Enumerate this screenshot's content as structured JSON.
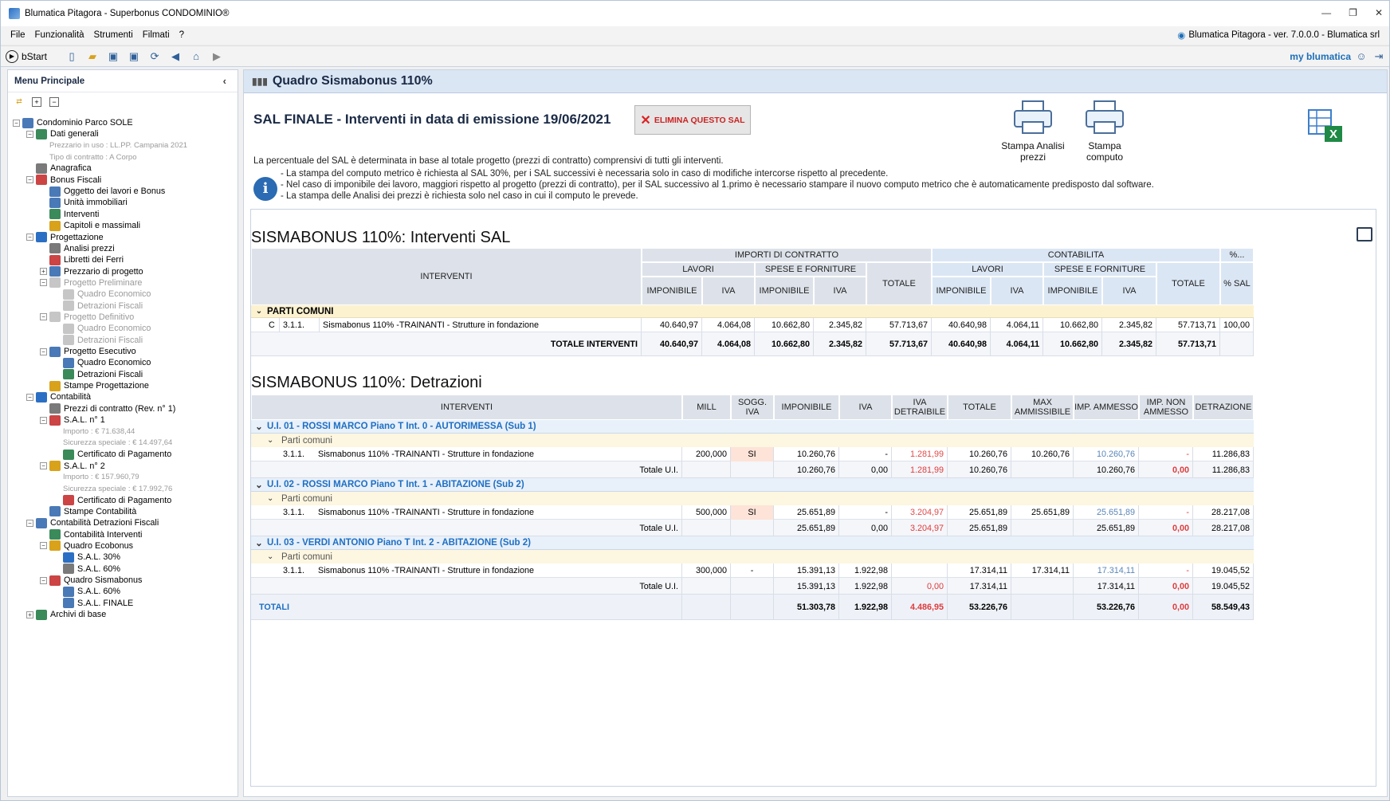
{
  "window": {
    "title": "Blumatica Pitagora - Superbonus CONDOMINIO®",
    "version": "Blumatica Pitagora - ver. 7.0.0.0 - Blumatica srl"
  },
  "menu": [
    "File",
    "Funzionalità",
    "Strumenti",
    "Filmati",
    "?"
  ],
  "toolbar": {
    "bstart": "bStart",
    "brand": "my blumatica"
  },
  "sidebar": {
    "title": "Menu Principale",
    "tree": [
      {
        "label": "Condominio Parco SOLE",
        "level": 0,
        "exp": "-"
      },
      {
        "label": "Dati generali",
        "level": 1,
        "exp": "-"
      },
      {
        "label": "Prezzario in uso : LL.PP. Campania 2021",
        "level": 2,
        "grey": true
      },
      {
        "label": "Tipo di contratto : A Corpo",
        "level": 2,
        "grey": true
      },
      {
        "label": "Anagrafica",
        "level": 1
      },
      {
        "label": "Bonus Fiscali",
        "level": 1,
        "exp": "-"
      },
      {
        "label": "Oggetto dei lavori e Bonus",
        "level": 2
      },
      {
        "label": "Unità immobiliari",
        "level": 2
      },
      {
        "label": "Interventi",
        "level": 2
      },
      {
        "label": "Capitoli e massimali",
        "level": 2
      },
      {
        "label": "Progettazione",
        "level": 1,
        "exp": "-"
      },
      {
        "label": "Analisi prezzi",
        "level": 2
      },
      {
        "label": "Libretti dei Ferri",
        "level": 2
      },
      {
        "label": "Prezzario di progetto",
        "level": 2,
        "exp": "+"
      },
      {
        "label": "Progetto Preliminare",
        "level": 2,
        "exp": "-",
        "dim": true
      },
      {
        "label": "Quadro Economico",
        "level": 3,
        "dim": true
      },
      {
        "label": "Detrazioni Fiscali",
        "level": 3,
        "dim": true
      },
      {
        "label": "Progetto Definitivo",
        "level": 2,
        "exp": "-",
        "dim": true
      },
      {
        "label": "Quadro Economico",
        "level": 3,
        "dim": true
      },
      {
        "label": "Detrazioni Fiscali",
        "level": 3,
        "dim": true
      },
      {
        "label": "Progetto Esecutivo",
        "level": 2,
        "exp": "-"
      },
      {
        "label": "Quadro Economico",
        "level": 3
      },
      {
        "label": "Detrazioni Fiscali",
        "level": 3
      },
      {
        "label": "Stampe Progettazione",
        "level": 2
      },
      {
        "label": "Contabilità",
        "level": 1,
        "exp": "-"
      },
      {
        "label": "Prezzi di contratto (Rev. n° 1)",
        "level": 2
      },
      {
        "label": "S.A.L. n° 1",
        "level": 2,
        "exp": "-"
      },
      {
        "label": "Importo : € 71.638,44",
        "level": 3,
        "grey": true
      },
      {
        "label": "Sicurezza speciale : € 14.497,64",
        "level": 3,
        "grey": true
      },
      {
        "label": "Certificato di Pagamento",
        "level": 3
      },
      {
        "label": "S.A.L. n° 2",
        "level": 2,
        "exp": "-"
      },
      {
        "label": "Importo : € 157.960,79",
        "level": 3,
        "grey": true
      },
      {
        "label": "Sicurezza speciale : € 17.992,76",
        "level": 3,
        "grey": true
      },
      {
        "label": "Certificato di Pagamento",
        "level": 3
      },
      {
        "label": "Stampe Contabilità",
        "level": 2
      },
      {
        "label": "Contabilità Detrazioni Fiscali",
        "level": 1,
        "exp": "-"
      },
      {
        "label": "Contabilità Interventi",
        "level": 2
      },
      {
        "label": "Quadro Ecobonus",
        "level": 2,
        "exp": "-"
      },
      {
        "label": "S.A.L. 30%",
        "level": 3
      },
      {
        "label": "S.A.L. 60%",
        "level": 3
      },
      {
        "label": "Quadro Sismabonus",
        "level": 2,
        "exp": "-"
      },
      {
        "label": "S.A.L. 60%",
        "level": 3
      },
      {
        "label": "S.A.L. FINALE",
        "level": 3
      },
      {
        "label": "Archivi di base",
        "level": 1,
        "exp": "+"
      }
    ]
  },
  "main": {
    "header": "Quadro Sismabonus 110%",
    "sal_title": "SAL FINALE - Interventi in data di emissione 19/06/2021",
    "delete_button": "ELIMINA QUESTO SAL",
    "print_analysis": [
      "Stampa Analisi",
      "prezzi"
    ],
    "print_computo": [
      "Stampa",
      "computo"
    ],
    "pct_note": "La percentuale del SAL è determinata in base al totale progetto (prezzi di contratto) comprensivi di tutti gli interventi.",
    "notes": [
      "- La stampa del computo metrico è richiesta al SAL 30%, per i SAL successivi è necessaria solo in caso di modifiche intercorse rispetto al precedente.",
      "- Nel caso di imponibile dei lavoro, maggiori rispetto al progetto (prezzi di contratto), per il SAL successivo al 1.primo è necessario stampare il nuovo computo metrico che è automaticamente predisposto dal software.",
      "- La stampa delle Analisi dei prezzi è richiesta solo nel caso in cui il computo le prevede."
    ]
  },
  "sal_table": {
    "title": "SISMABONUS 110%: Interventi SAL",
    "headers": {
      "interventi": "INTERVENTI",
      "importi": "IMPORTI DI CONTRATTO",
      "contabilita": "CONTABILITA",
      "pct": "%...",
      "lavori": "LAVORI",
      "spese": "SPESE E FORNITURE",
      "totale": "TOTALE",
      "imponibile": "IMPONIBILE",
      "iva": "IVA",
      "pct_sal": "% SAL"
    },
    "group": "PARTI COMUNI",
    "row": {
      "type": "C",
      "code": "3.1.1.",
      "desc": "Sismabonus 110% -TRAINANTI - Strutture in fondazione",
      "v": [
        "40.640,97",
        "4.064,08",
        "10.662,80",
        "2.345,82",
        "57.713,67",
        "40.640,98",
        "4.064,11",
        "10.662,80",
        "2.345,82",
        "57.713,71",
        "100,00"
      ]
    },
    "total_label": "TOTALE INTERVENTI",
    "total": [
      "40.640,97",
      "4.064,08",
      "10.662,80",
      "2.345,82",
      "57.713,67",
      "40.640,98",
      "4.064,11",
      "10.662,80",
      "2.345,82",
      "57.713,71",
      ""
    ]
  },
  "detr_table": {
    "title": "SISMABONUS 110%: Detrazioni",
    "headers": [
      "INTERVENTI",
      "MILL",
      "SOGG. IVA",
      "IMPONIBILE",
      "IVA",
      "IVA DETRAIBILE",
      "TOTALE",
      "MAX AMMISSIBILE",
      "IMP. AMMESSO",
      "IMP. NON AMMESSO",
      "DETRAZIONE"
    ],
    "sub_label": "Parti comuni",
    "totale_ui_label": "Totale U.I.",
    "units": [
      {
        "name": "U.I. 01 -  ROSSI MARCO Piano T Int. 0 - AUTORIMESSA (Sub 1)",
        "row": [
          "3.1.1.",
          "Sismabonus 110% -TRAINANTI - Strutture in fondazione",
          "200,000",
          "SI",
          "10.260,76",
          "-",
          "1.281,99",
          "10.260,76",
          "10.260,76",
          "10.260,76",
          "-",
          "11.286,83"
        ],
        "tot": [
          "10.260,76",
          "0,00",
          "1.281,99",
          "10.260,76",
          "",
          "10.260,76",
          "0,00",
          "11.286,83"
        ]
      },
      {
        "name": "U.I. 02 -  ROSSI MARCO Piano T Int. 1 - ABITAZIONE (Sub 2)",
        "row": [
          "3.1.1.",
          "Sismabonus 110% -TRAINANTI - Strutture in fondazione",
          "500,000",
          "SI",
          "25.651,89",
          "-",
          "3.204,97",
          "25.651,89",
          "25.651,89",
          "25.651,89",
          "-",
          "28.217,08"
        ],
        "tot": [
          "25.651,89",
          "0,00",
          "3.204,97",
          "25.651,89",
          "",
          "25.651,89",
          "0,00",
          "28.217,08"
        ]
      },
      {
        "name": "U.I. 03 - VERDI ANTONIO  Piano T Int. 2 - ABITAZIONE (Sub 2)",
        "row": [
          "3.1.1.",
          "Sismabonus 110% -TRAINANTI - Strutture in fondazione",
          "300,000",
          "-",
          "15.391,13",
          "1.922,98",
          "",
          "17.314,11",
          "17.314,11",
          "17.314,11",
          "-",
          "19.045,52"
        ],
        "tot": [
          "15.391,13",
          "1.922,98",
          "0,00",
          "17.314,11",
          "",
          "17.314,11",
          "0,00",
          "19.045,52"
        ]
      }
    ],
    "totals_label": "TOTALI",
    "totals": [
      "51.303,78",
      "1.922,98",
      "4.486,95",
      "53.226,76",
      "",
      "53.226,76",
      "0,00",
      "58.549,43"
    ]
  }
}
